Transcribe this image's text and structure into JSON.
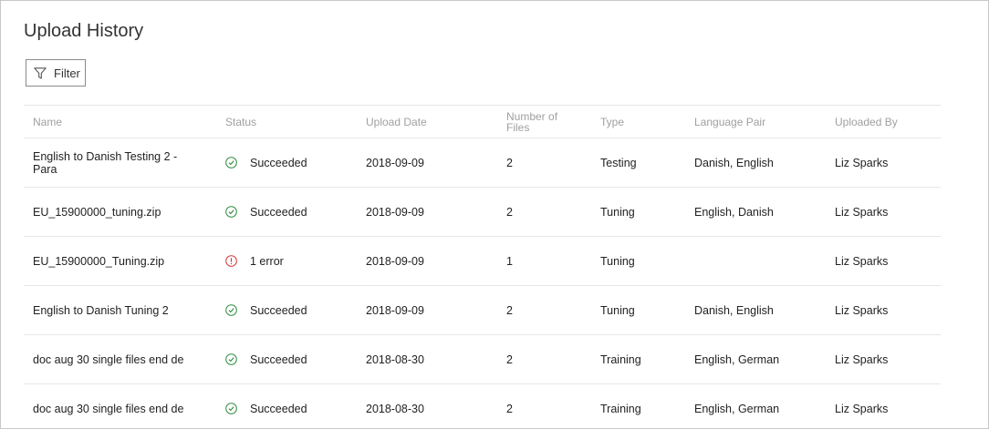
{
  "page": {
    "title": "Upload History"
  },
  "toolbar": {
    "filter_label": "Filter",
    "filter_icon": "filter-funnel-icon"
  },
  "table": {
    "headers": {
      "name": "Name",
      "status": "Status",
      "upload_date": "Upload Date",
      "number_of_files_line1": "Number of",
      "number_of_files_line2": "Files",
      "type": "Type",
      "language_pair": "Language Pair",
      "uploaded_by": "Uploaded By"
    },
    "rows": [
      {
        "name_line1": "English to Danish Testing 2 -",
        "name_line2": "Para",
        "status": "Succeeded",
        "status_kind": "success",
        "date": "2018-09-09",
        "files": "2",
        "type": "Testing",
        "language_pair": "Danish, English",
        "uploaded_by": "Liz Sparks"
      },
      {
        "name_line1": "EU_15900000_tuning.zip",
        "name_line2": "",
        "status": "Succeeded",
        "status_kind": "success",
        "date": "2018-09-09",
        "files": "2",
        "type": "Tuning",
        "language_pair": "English, Danish",
        "uploaded_by": "Liz Sparks"
      },
      {
        "name_line1": "EU_15900000_Tuning.zip",
        "name_line2": "",
        "status": "1 error",
        "status_kind": "error",
        "date": "2018-09-09",
        "files": "1",
        "type": "Tuning",
        "language_pair": "",
        "uploaded_by": "Liz Sparks"
      },
      {
        "name_line1": "English to Danish Tuning 2",
        "name_line2": "",
        "status": "Succeeded",
        "status_kind": "success",
        "date": "2018-09-09",
        "files": "2",
        "type": "Tuning",
        "language_pair": "Danish, English",
        "uploaded_by": "Liz Sparks"
      },
      {
        "name_line1": "doc aug 30 single files end de",
        "name_line2": "",
        "status": "Succeeded",
        "status_kind": "success",
        "date": "2018-08-30",
        "files": "2",
        "type": "Training",
        "language_pair": "English, German",
        "uploaded_by": "Liz Sparks"
      },
      {
        "name_line1": "doc aug 30 single files end de",
        "name_line2": "",
        "status": "Succeeded",
        "status_kind": "success",
        "date": "2018-08-30",
        "files": "2",
        "type": "Training",
        "language_pair": "English, German",
        "uploaded_by": "Liz Sparks"
      }
    ]
  },
  "colors": {
    "success": "#2e8b3e",
    "error": "#d13438",
    "header_text": "#a0a0a0",
    "divider": "#e6e6e6"
  }
}
